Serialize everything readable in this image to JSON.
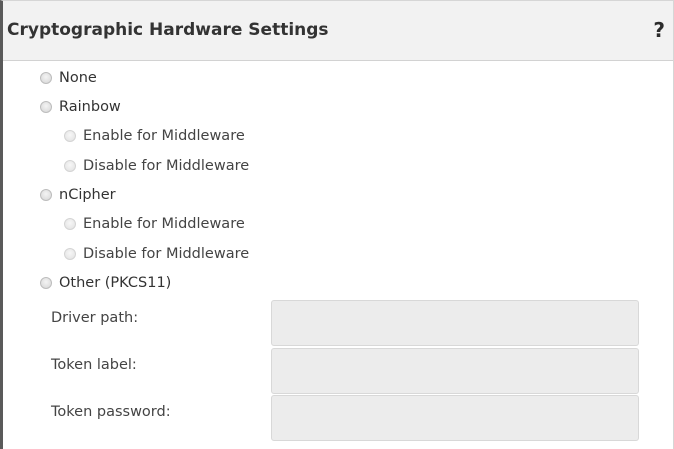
{
  "panel": {
    "title": "Cryptographic Hardware Settings",
    "help_label": "?"
  },
  "options": {
    "none": {
      "label": "None"
    },
    "rainbow": {
      "label": "Rainbow",
      "enable_label": "Enable for Middleware",
      "disable_label": "Disable for Middleware"
    },
    "ncipher": {
      "label": "nCipher",
      "enable_label": "Enable for Middleware",
      "disable_label": "Disable for Middleware"
    },
    "other": {
      "label": "Other (PKCS11)"
    }
  },
  "fields": {
    "driver_path": {
      "label": "Driver path:",
      "value": "",
      "placeholder": ""
    },
    "token_label": {
      "label": "Token label:",
      "value": "",
      "placeholder": ""
    },
    "token_password": {
      "label": "Token password:",
      "value": "",
      "placeholder": ""
    }
  },
  "colors": {
    "header_bg": "#f2f2f2",
    "input_bg": "#ececec",
    "text": "#333333"
  }
}
